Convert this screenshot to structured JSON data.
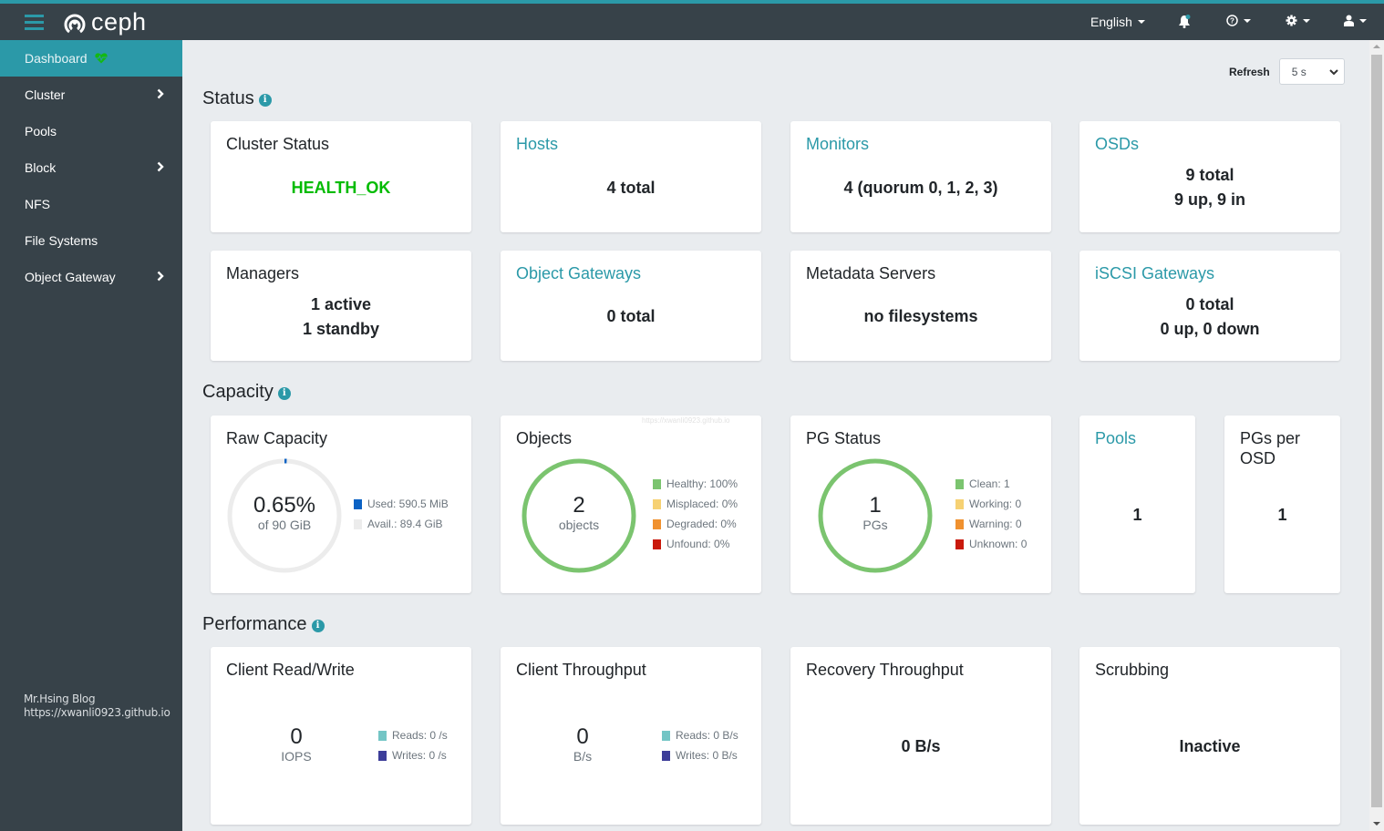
{
  "app": {
    "brand": "ceph"
  },
  "navbar": {
    "language": "English",
    "icons": [
      "menu-icon",
      "bell-icon",
      "help-icon",
      "gear-icon",
      "user-icon"
    ]
  },
  "sidebar": {
    "items": [
      {
        "label": "Dashboard",
        "active": true,
        "icon": "heartbeat-icon"
      },
      {
        "label": "Cluster",
        "submenu": true
      },
      {
        "label": "Pools"
      },
      {
        "label": "Block",
        "submenu": true
      },
      {
        "label": "NFS"
      },
      {
        "label": "File Systems"
      },
      {
        "label": "Object Gateway",
        "submenu": true
      }
    ],
    "footer": {
      "line1": "Mr.Hsing Blog",
      "line2": "https://xwanli0923.github.io"
    }
  },
  "refresh": {
    "label": "Refresh",
    "value": "5 s"
  },
  "sections": {
    "status": "Status",
    "capacity": "Capacity",
    "performance": "Performance"
  },
  "status": {
    "cluster_status": {
      "title": "Cluster Status",
      "value": "HEALTH_OK"
    },
    "hosts": {
      "title": "Hosts",
      "value": "4 total"
    },
    "monitors": {
      "title": "Monitors",
      "value": "4 (quorum 0, 1, 2, 3)"
    },
    "osds": {
      "title": "OSDs",
      "line1": "9 total",
      "line2": "9 up, 9 in"
    },
    "managers": {
      "title": "Managers",
      "line1": "1 active",
      "line2": "1 standby"
    },
    "object_gateways": {
      "title": "Object Gateways",
      "value": "0 total"
    },
    "metadata_servers": {
      "title": "Metadata Servers",
      "value": "no filesystems"
    },
    "iscsi_gateways": {
      "title": "iSCSI Gateways",
      "line1": "0 total",
      "line2": "0 up, 0 down"
    }
  },
  "capacity": {
    "raw": {
      "title": "Raw Capacity",
      "percent_text": "0.65%",
      "used_fraction": 0.0065,
      "subtitle": "of 90 GiB",
      "legend": [
        {
          "label": "Used: 590.5 MiB",
          "color": "#0b62c4"
        },
        {
          "label": "Avail.: 89.4 GiB",
          "color": "#ececec"
        }
      ]
    },
    "objects": {
      "title": "Objects",
      "count": "2",
      "unit": "objects",
      "legend": [
        {
          "label": "Healthy: 100%",
          "color": "#7bc46f"
        },
        {
          "label": "Misplaced: 0%",
          "color": "#f6d173"
        },
        {
          "label": "Degraded: 0%",
          "color": "#f0912f"
        },
        {
          "label": "Unfound: 0%",
          "color": "#c9190b"
        }
      ]
    },
    "pg_status": {
      "title": "PG Status",
      "count": "1",
      "unit": "PGs",
      "legend": [
        {
          "label": "Clean: 1",
          "color": "#7bc46f"
        },
        {
          "label": "Working: 0",
          "color": "#f6d173"
        },
        {
          "label": "Warning: 0",
          "color": "#f0912f"
        },
        {
          "label": "Unknown: 0",
          "color": "#c9190b"
        }
      ]
    },
    "pools": {
      "title": "Pools",
      "value": "1"
    },
    "pgs_per_osd": {
      "title": "PGs per OSD",
      "value": "1"
    }
  },
  "performance": {
    "client_rw": {
      "title": "Client Read/Write",
      "value": "0",
      "unit": "IOPS",
      "legend": [
        {
          "label": "Reads: 0 /s",
          "color": "#73c5c5"
        },
        {
          "label": "Writes: 0 /s",
          "color": "#3c3d99"
        }
      ]
    },
    "client_throughput": {
      "title": "Client Throughput",
      "value": "0",
      "unit": "B/s",
      "legend": [
        {
          "label": "Reads: 0 B/s",
          "color": "#73c5c5"
        },
        {
          "label": "Writes: 0 B/s",
          "color": "#3c3d99"
        }
      ]
    },
    "recovery_throughput": {
      "title": "Recovery Throughput",
      "value": "0 B/s"
    },
    "scrubbing": {
      "title": "Scrubbing",
      "value": "Inactive"
    }
  },
  "watermark": "https://xwanli0923.github.io",
  "colors": {
    "accent": "#2b99a8",
    "navbar": "#374249",
    "health_ok": "#00bb00"
  }
}
